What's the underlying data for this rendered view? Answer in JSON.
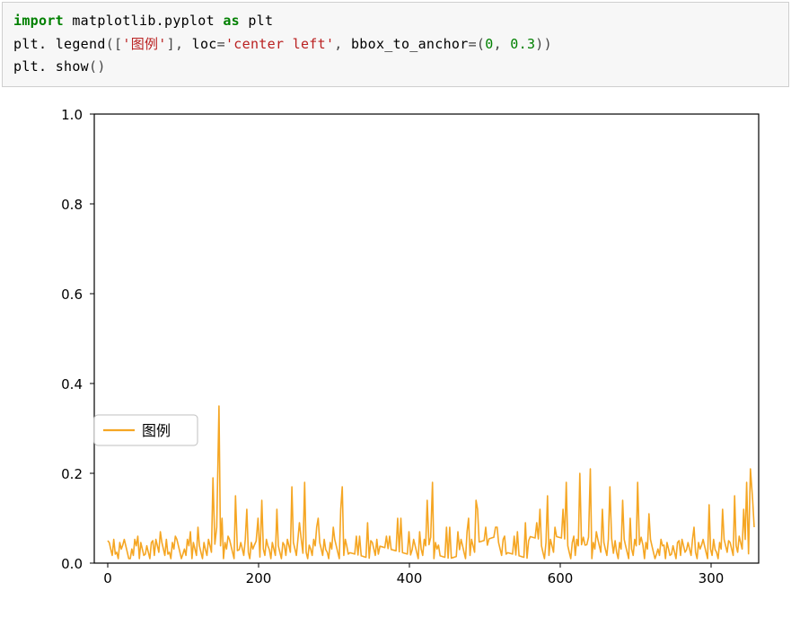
{
  "code": {
    "line1_import": "import",
    "line1_module": "matplotlib.pyplot",
    "line1_as": "as",
    "line1_alias": "plt",
    "line2_obj": "plt",
    "line2_fn": "legend",
    "line2_arg_legend": "'图例'",
    "line2_arg_loc_key": "loc",
    "line2_arg_loc_val": "'center left'",
    "line2_arg_bbox_key": "bbox_to_anchor",
    "line2_arg_bbox_val0": "0",
    "line2_arg_bbox_val1": "0.3",
    "line3_obj": "plt",
    "line3_fn": "show"
  },
  "chart_data": {
    "type": "line",
    "series": [
      {
        "name": "图例",
        "color": "#f5a623"
      }
    ],
    "x_range": [
      0,
      860
    ],
    "xticks": [
      0,
      200,
      400,
      600,
      "300"
    ],
    "y_range": [
      0.0,
      1.0
    ],
    "yticks": [
      "0.0",
      "0.2",
      "0.4",
      "0.6",
      "0.8",
      "1.0"
    ],
    "legend": {
      "label": "图例",
      "position": "left, y≈0.3"
    },
    "note": "Dense noisy signal roughly bounded 0–0.1 with frequent spikes 0.05–0.20; max spike ≈0.35 near x≈150; moderate spikes around x 600–720; slight rise near right edge.",
    "sample_values": [
      [
        0,
        0.05
      ],
      [
        10,
        0.02
      ],
      [
        20,
        0.04
      ],
      [
        30,
        0.01
      ],
      [
        40,
        0.06
      ],
      [
        50,
        0.02
      ],
      [
        60,
        0.05
      ],
      [
        70,
        0.07
      ],
      [
        80,
        0.02
      ],
      [
        90,
        0.06
      ],
      [
        100,
        0.02
      ],
      [
        110,
        0.07
      ],
      [
        120,
        0.08
      ],
      [
        130,
        0.03
      ],
      [
        140,
        0.19
      ],
      [
        145,
        0.08
      ],
      [
        148,
        0.35
      ],
      [
        152,
        0.1
      ],
      [
        160,
        0.06
      ],
      [
        170,
        0.15
      ],
      [
        175,
        0.03
      ],
      [
        185,
        0.12
      ],
      [
        195,
        0.04
      ],
      [
        200,
        0.1
      ],
      [
        205,
        0.14
      ],
      [
        215,
        0.03
      ],
      [
        225,
        0.12
      ],
      [
        235,
        0.04
      ],
      [
        245,
        0.17
      ],
      [
        255,
        0.09
      ],
      [
        262,
        0.18
      ],
      [
        268,
        0.04
      ],
      [
        280,
        0.1
      ],
      [
        290,
        0.03
      ],
      [
        300,
        0.08
      ],
      [
        312,
        0.17
      ],
      [
        320,
        0.02
      ],
      [
        335,
        0.06
      ],
      [
        350,
        0.05
      ],
      [
        360,
        0.02
      ],
      [
        375,
        0.06
      ],
      [
        390,
        0.1
      ],
      [
        405,
        0.03
      ],
      [
        415,
        0.07
      ],
      [
        425,
        0.14
      ],
      [
        432,
        0.18
      ],
      [
        440,
        0.04
      ],
      [
        455,
        0.08
      ],
      [
        468,
        0.03
      ],
      [
        480,
        0.1
      ],
      [
        492,
        0.12
      ],
      [
        505,
        0.04
      ],
      [
        518,
        0.08
      ],
      [
        530,
        0.02
      ],
      [
        545,
        0.07
      ],
      [
        560,
        0.05
      ],
      [
        575,
        0.12
      ],
      [
        585,
        0.15
      ],
      [
        595,
        0.08
      ],
      [
        610,
        0.18
      ],
      [
        620,
        0.06
      ],
      [
        628,
        0.2
      ],
      [
        635,
        0.04
      ],
      [
        642,
        0.21
      ],
      [
        650,
        0.07
      ],
      [
        658,
        0.12
      ],
      [
        668,
        0.17
      ],
      [
        675,
        0.05
      ],
      [
        685,
        0.14
      ],
      [
        695,
        0.1
      ],
      [
        705,
        0.18
      ],
      [
        712,
        0.04
      ],
      [
        720,
        0.11
      ],
      [
        730,
        0.02
      ],
      [
        740,
        0.04
      ],
      [
        750,
        0.02
      ],
      [
        760,
        0.05
      ],
      [
        770,
        0.03
      ],
      [
        780,
        0.08
      ],
      [
        790,
        0.04
      ],
      [
        800,
        0.13
      ],
      [
        808,
        0.03
      ],
      [
        818,
        0.12
      ],
      [
        826,
        0.05
      ],
      [
        834,
        0.15
      ],
      [
        840,
        0.06
      ],
      [
        846,
        0.12
      ],
      [
        850,
        0.18
      ],
      [
        855,
        0.21
      ],
      [
        858,
        0.14
      ],
      [
        860,
        0.08
      ]
    ]
  }
}
